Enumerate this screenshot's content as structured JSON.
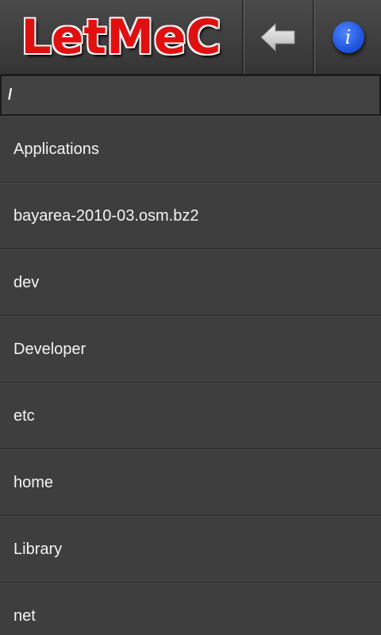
{
  "header": {
    "logo_text": "LetMeC",
    "back_button_icon": "back-arrow-icon",
    "info_button_icon": "info-icon",
    "info_glyph": "i"
  },
  "path": {
    "value": "/"
  },
  "files": [
    {
      "name": "Applications"
    },
    {
      "name": "bayarea-2010-03.osm.bz2"
    },
    {
      "name": "dev"
    },
    {
      "name": "Developer"
    },
    {
      "name": "etc"
    },
    {
      "name": "home"
    },
    {
      "name": "Library"
    },
    {
      "name": "net"
    }
  ],
  "colors": {
    "logo_red": "#e01010",
    "info_blue": "#1a4fd8",
    "background": "#3c3c3c"
  }
}
